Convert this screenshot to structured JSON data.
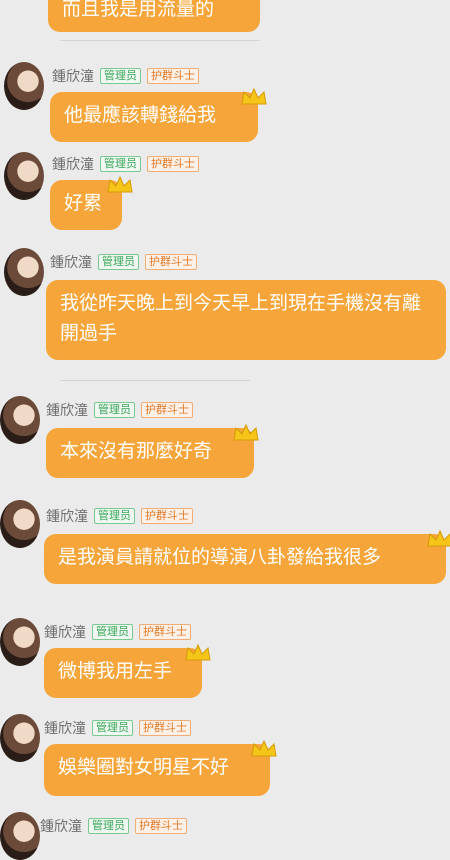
{
  "messages": [
    {
      "text": "而且我是用流量的",
      "name": "",
      "admin": "",
      "guard": ""
    },
    {
      "text": "他最應該轉錢給我",
      "name": "鍾欣潼",
      "admin": "管理员",
      "guard": "护群斗士"
    },
    {
      "text": "好累",
      "name": "鍾欣潼",
      "admin": "管理员",
      "guard": "护群斗士"
    },
    {
      "text": "我從昨天晚上到今天早上到現在手機沒有離開過手",
      "name": "鍾欣潼",
      "admin": "管理员",
      "guard": "护群斗士"
    },
    {
      "text": "本來沒有那麼好奇",
      "name": "鍾欣潼",
      "admin": "管理员",
      "guard": "护群斗士"
    },
    {
      "text": "是我演員請就位的導演八卦發給我很多",
      "name": "鍾欣潼",
      "admin": "管理员",
      "guard": "护群斗士"
    },
    {
      "text": "微博我用左手",
      "name": "鍾欣潼",
      "admin": "管理员",
      "guard": "护群斗士"
    },
    {
      "text": "娛樂圈對女明星不好",
      "name": "鍾欣潼",
      "admin": "管理员",
      "guard": "护群斗士"
    },
    {
      "text": "",
      "name": "鍾欣潼",
      "admin": "管理员",
      "guard": "护群斗士"
    }
  ],
  "colors": {
    "bubble": "#f6a53a",
    "admin_badge": "#3ba55c",
    "guard_badge": "#e0792a"
  },
  "icons": {
    "crown": "crown-icon",
    "avatar": "avatar"
  }
}
